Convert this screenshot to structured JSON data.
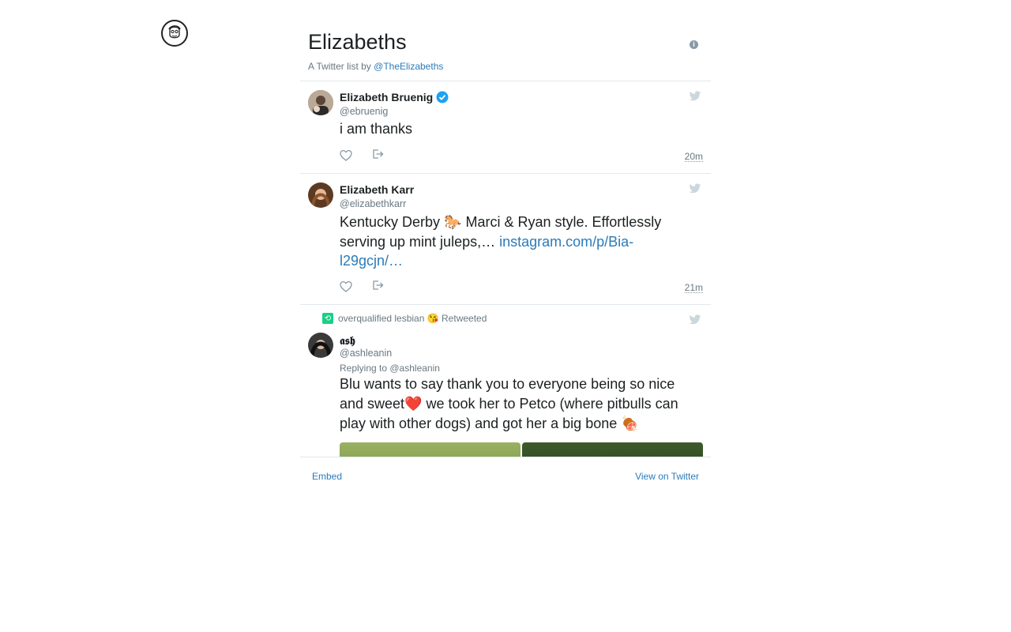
{
  "site": {
    "logo_icon": "face-sketch-logo"
  },
  "header": {
    "title": "Elizabeths",
    "subtitle_prefix": "A Twitter list by ",
    "owner": "@TheElizabeths",
    "info_glyph": "i"
  },
  "tweets": [
    {
      "name": "Elizabeth Bruenig",
      "handle": "@ebruenig",
      "verified": true,
      "text": "i am thanks",
      "time": "20m"
    },
    {
      "name": "Elizabeth Karr",
      "handle": "@elizabethkarr",
      "text_before": "Kentucky Derby 🐎 Marci & Ryan style. Effortlessly serving up mint juleps,… ",
      "link": "instagram.com/p/Bia-l29gcjn/…",
      "time": "21m"
    },
    {
      "retweeted_by": "overqualified lesbian 😘 Retweeted",
      "name": "𝖆𝖘𝖍",
      "handle": "@ashleanin",
      "replying_to": "Replying to @ashleanin",
      "text": "Blu wants to say thank you to everyone being so nice and sweet❤️ we took her to Petco (where pitbulls can play with other dogs) and got her a big bone 🍖"
    }
  ],
  "footer": {
    "embed": "Embed",
    "view": "View on Twitter"
  },
  "colors": {
    "link": "#2b7bb9",
    "verified": "#1da1f2",
    "retweet": "#19cf86",
    "muted": "#697882"
  }
}
